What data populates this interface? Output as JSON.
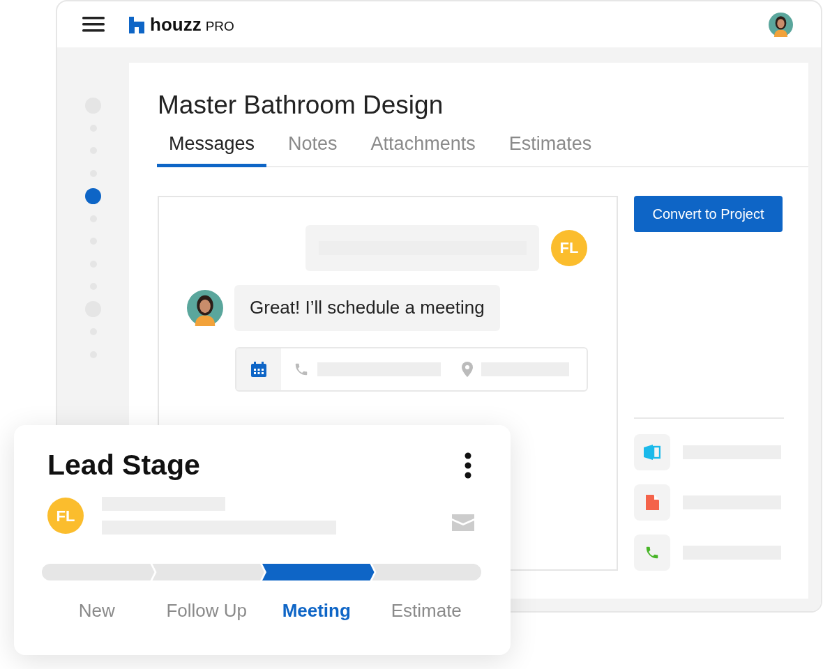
{
  "header": {
    "logo_text": "houzz",
    "logo_suffix": "PRO"
  },
  "timeline": [
    {
      "kind": "large",
      "selected": false
    },
    {
      "kind": "small",
      "selected": false
    },
    {
      "kind": "small",
      "selected": false
    },
    {
      "kind": "small",
      "selected": false
    },
    {
      "kind": "large",
      "selected": true
    },
    {
      "kind": "small",
      "selected": false
    },
    {
      "kind": "small",
      "selected": false
    },
    {
      "kind": "small",
      "selected": false
    },
    {
      "kind": "small",
      "selected": false
    },
    {
      "kind": "large",
      "selected": false
    },
    {
      "kind": "small",
      "selected": false
    },
    {
      "kind": "small",
      "selected": false
    }
  ],
  "project": {
    "title": "Master Bathroom Design"
  },
  "tabs": [
    {
      "label": "Messages",
      "selected": true
    },
    {
      "label": "Notes",
      "selected": false
    },
    {
      "label": "Attachments",
      "selected": false
    },
    {
      "label": "Estimates",
      "selected": false
    }
  ],
  "messages": [
    {
      "kind": "outgoing",
      "initials": "FL"
    },
    {
      "kind": "incoming",
      "text": "Great! I’ll schedule a meeting"
    },
    {
      "kind": "meeting"
    }
  ],
  "convert_button": "Convert to Project",
  "side_items": [
    {
      "kind": "document"
    },
    {
      "kind": "file"
    },
    {
      "kind": "phone"
    }
  ],
  "lead_stage": {
    "title": "Lead Stage",
    "initials": "FL",
    "stages": [
      {
        "label": "New",
        "selected": false
      },
      {
        "label": "Follow Up",
        "selected": false
      },
      {
        "label": "Meeting",
        "selected": true
      },
      {
        "label": "Estimate",
        "selected": false
      }
    ]
  }
}
